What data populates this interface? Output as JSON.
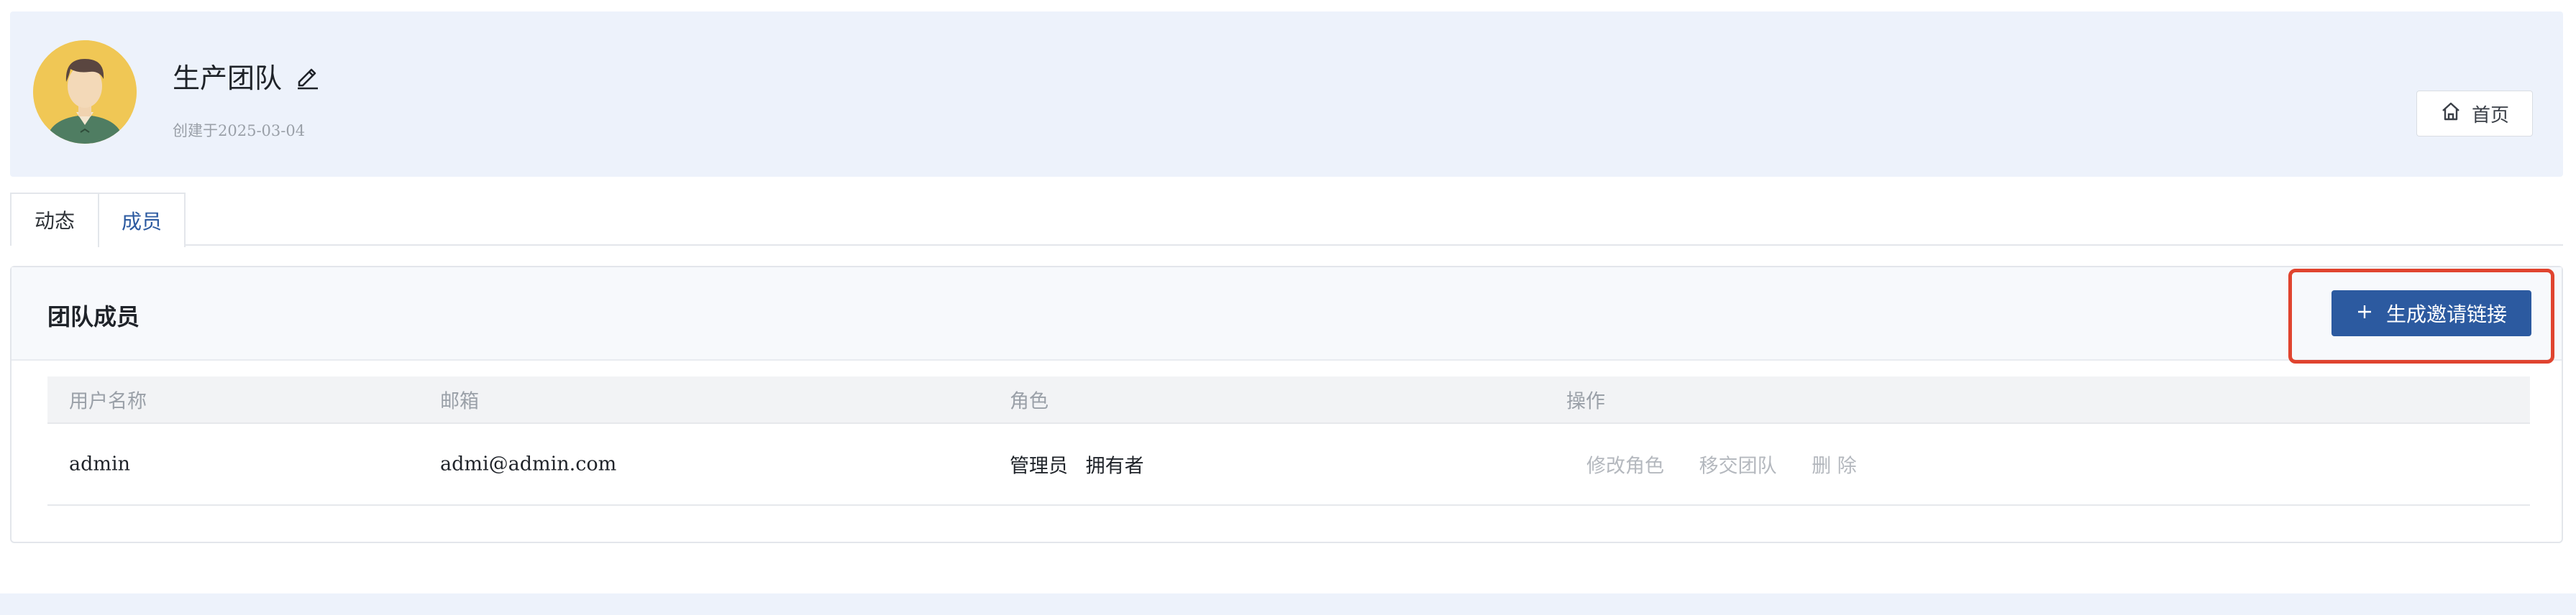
{
  "header": {
    "team_name": "生产团队",
    "created_text": "创建于2025-03-04",
    "home_label": "首页"
  },
  "tabs": [
    {
      "label": "动态",
      "active": false
    },
    {
      "label": "成员",
      "active": true
    }
  ],
  "members_panel": {
    "title": "团队成员",
    "invite_label": "生成邀请链接",
    "columns": [
      "用户名称",
      "邮箱",
      "角色",
      "操作"
    ],
    "rows": [
      {
        "username": "admin",
        "email": "admi@admin.com",
        "roles": [
          "管理员",
          "拥有者"
        ],
        "actions": [
          "修改角色",
          "移交团队",
          "删 除"
        ]
      }
    ]
  },
  "colors": {
    "primary": "#2c5aa0",
    "header_bg": "#edf2fb",
    "highlight": "#e0442f",
    "muted_text": "#9aa0a8"
  }
}
